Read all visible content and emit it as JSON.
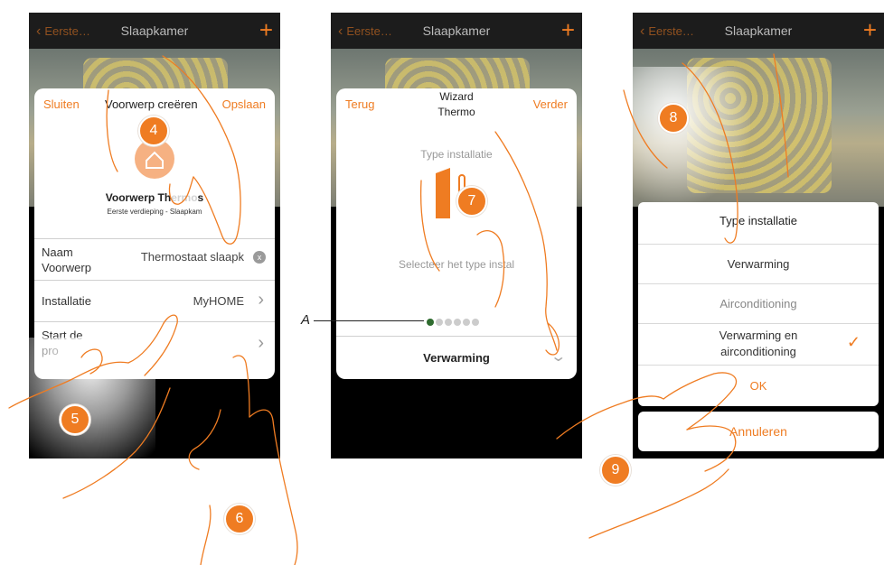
{
  "screen1": {
    "back": "Eerste…",
    "title": "Slaapkamer",
    "plus": "+",
    "close": "Sluiten",
    "header_bold": "Voorwerp",
    "header_rest": " creëren",
    "save": "Opslaan",
    "object_title": "Voorwerp Th",
    "object_title_end": "s",
    "object_subtitle": "Eerste verdieping - Slaapkam",
    "name_label": "Naam Voorwerp",
    "name_value": "Thermostaat slaapk",
    "install_label": "Installatie",
    "install_value": "MyHOME",
    "start_label": "Start de",
    "start_label2": "pro"
  },
  "screen2": {
    "back": "Eerste…",
    "title": "Slaapkamer",
    "plus": "+",
    "back_button": "Terug",
    "wizard_title": "Wizard Thermo",
    "next": "Verder",
    "type_label": "Type installatie",
    "select_label": "Selecteer het type instal",
    "selected": "Verwarming"
  },
  "screen3": {
    "back": "Eerste…",
    "title": "Slaapkamer",
    "plus": "+",
    "sheet_title": "Type installatie",
    "options": [
      "Verwarming",
      "Airconditioning",
      "Verwarming en airconditioning"
    ],
    "ok": "OK",
    "cancel": "Annuleren"
  },
  "callouts": {
    "n4": "4",
    "n5": "5",
    "n6": "6",
    "n7": "7",
    "n8": "8",
    "n9": "9",
    "a": "A"
  },
  "colors": {
    "accent": "#ef7c22",
    "dot_active": "#2e6b2e",
    "dot_inactive": "#cccccc"
  }
}
